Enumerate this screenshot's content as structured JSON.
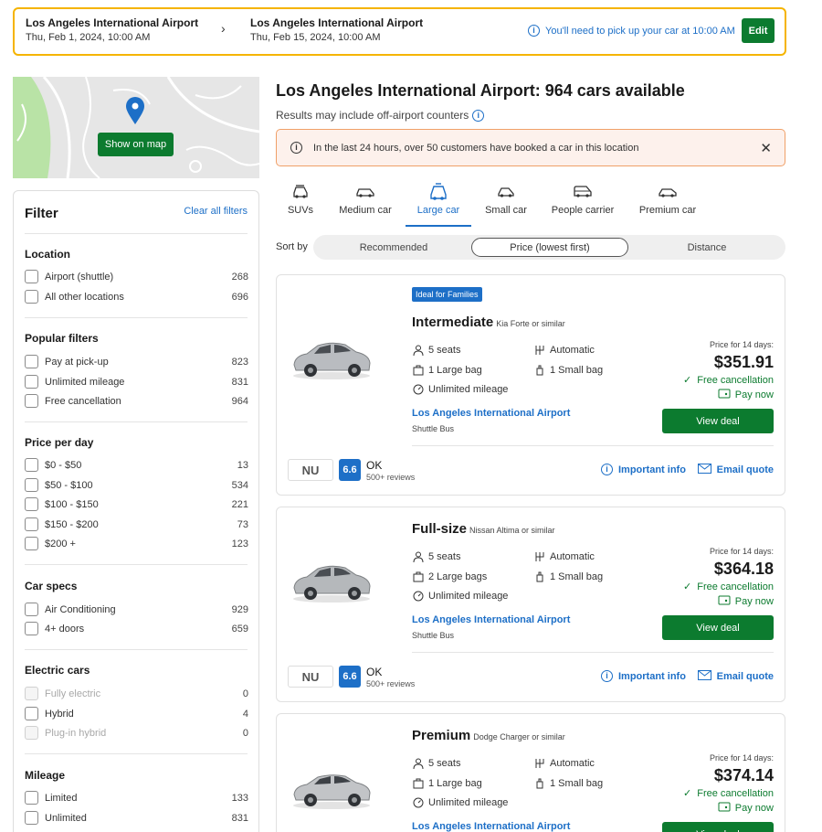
{
  "search": {
    "pickup_location": "Los Angeles International Airport",
    "pickup_datetime": "Thu, Feb 1, 2024, 10:00 AM",
    "dropoff_location": "Los Angeles International Airport",
    "dropoff_datetime": "Thu, Feb 15, 2024, 10:00 AM",
    "notice": "You'll need to pick up your car at 10:00 AM",
    "edit_label": "Edit"
  },
  "map": {
    "show_on_map_label": "Show on map"
  },
  "filter": {
    "title": "Filter",
    "clear_label": "Clear all filters",
    "sections": {
      "location": {
        "title": "Location",
        "items": [
          {
            "label": "Airport (shuttle)",
            "count": "268"
          },
          {
            "label": "All other locations",
            "count": "696"
          }
        ]
      },
      "popular": {
        "title": "Popular filters",
        "items": [
          {
            "label": "Pay at pick-up",
            "count": "823"
          },
          {
            "label": "Unlimited mileage",
            "count": "831"
          },
          {
            "label": "Free cancellation",
            "count": "964"
          }
        ]
      },
      "price": {
        "title": "Price per day",
        "items": [
          {
            "label": "$0 - $50",
            "count": "13"
          },
          {
            "label": "$50 - $100",
            "count": "534"
          },
          {
            "label": "$100 - $150",
            "count": "221"
          },
          {
            "label": "$150 - $200",
            "count": "73"
          },
          {
            "label": "$200 +",
            "count": "123"
          }
        ]
      },
      "specs": {
        "title": "Car specs",
        "items": [
          {
            "label": "Air Conditioning",
            "count": "929"
          },
          {
            "label": "4+ doors",
            "count": "659"
          }
        ]
      },
      "electric": {
        "title": "Electric cars",
        "items": [
          {
            "label": "Fully electric",
            "count": "0"
          },
          {
            "label": "Hybrid",
            "count": "4"
          },
          {
            "label": "Plug-in hybrid",
            "count": "0"
          }
        ]
      },
      "mileage": {
        "title": "Mileage",
        "items": [
          {
            "label": "Limited",
            "count": "133"
          },
          {
            "label": "Unlimited",
            "count": "831"
          }
        ]
      }
    }
  },
  "main": {
    "title": "Los Angeles International Airport: 964 cars available",
    "subtitle": "Results may include off-airport counters",
    "alert": "In the last 24 hours, over 50 customers have booked a car in this location",
    "tabs": [
      {
        "label": "SUVs",
        "icon": "suv-icon"
      },
      {
        "label": "Medium car",
        "icon": "medium-car-icon"
      },
      {
        "label": "Large car",
        "icon": "large-car-icon"
      },
      {
        "label": "Small car",
        "icon": "small-car-icon"
      },
      {
        "label": "People carrier",
        "icon": "people-carrier-icon"
      },
      {
        "label": "Premium car",
        "icon": "premium-car-icon"
      }
    ],
    "active_tab": "Large car",
    "sort": {
      "label": "Sort by",
      "options": [
        "Recommended",
        "Price (lowest first)",
        "Distance"
      ],
      "selected": "Price (lowest first)"
    }
  },
  "results": [
    {
      "badge": "Ideal for Families",
      "category": "Intermediate",
      "model": "Kia Forte or similar",
      "seats": "5 seats",
      "transmission": "Automatic",
      "large_bags": "1 Large bag",
      "small_bags": "1 Small bag",
      "mileage": "Unlimited mileage",
      "pickup": "Los Angeles International Airport",
      "pickup_type": "Shuttle Bus",
      "price_for": "Price for 14 days:",
      "price": "$351.91",
      "free_cancel": "Free cancellation",
      "pay_now": "Pay now",
      "view_deal": "View deal",
      "supplier": "NU",
      "score": "6.6",
      "rating": "OK",
      "reviews": "500+ reviews",
      "important_info": "Important info",
      "email_quote": "Email quote",
      "color": "#b9bcc0"
    },
    {
      "badge": "",
      "category": "Full-size",
      "model": "Nissan Altima or similar",
      "seats": "5 seats",
      "transmission": "Automatic",
      "large_bags": "2 Large bags",
      "small_bags": "1 Small bag",
      "mileage": "Unlimited mileage",
      "pickup": "Los Angeles International Airport",
      "pickup_type": "Shuttle Bus",
      "price_for": "Price for 14 days:",
      "price": "$364.18",
      "free_cancel": "Free cancellation",
      "pay_now": "Pay now",
      "view_deal": "View deal",
      "supplier": "NU",
      "score": "6.6",
      "rating": "OK",
      "reviews": "500+ reviews",
      "important_info": "Important info",
      "email_quote": "Email quote",
      "color": "#b5b8bb"
    },
    {
      "badge": "",
      "category": "Premium",
      "model": "Dodge Charger or similar",
      "seats": "5 seats",
      "transmission": "Automatic",
      "large_bags": "1 Large bag",
      "small_bags": "1 Small bag",
      "mileage": "Unlimited mileage",
      "pickup": "Los Angeles International Airport",
      "price_for": "Price for 14 days:",
      "price": "$374.14",
      "free_cancel": "Free cancellation",
      "pay_now": "Pay now",
      "view_deal": "View deal",
      "color": "#c2c4c7"
    }
  ],
  "colors": {
    "accent_blue": "#1d6fc7",
    "green": "#0c7b2f",
    "highlight_yellow": "#f5b400",
    "alert_border": "#f0a068"
  }
}
